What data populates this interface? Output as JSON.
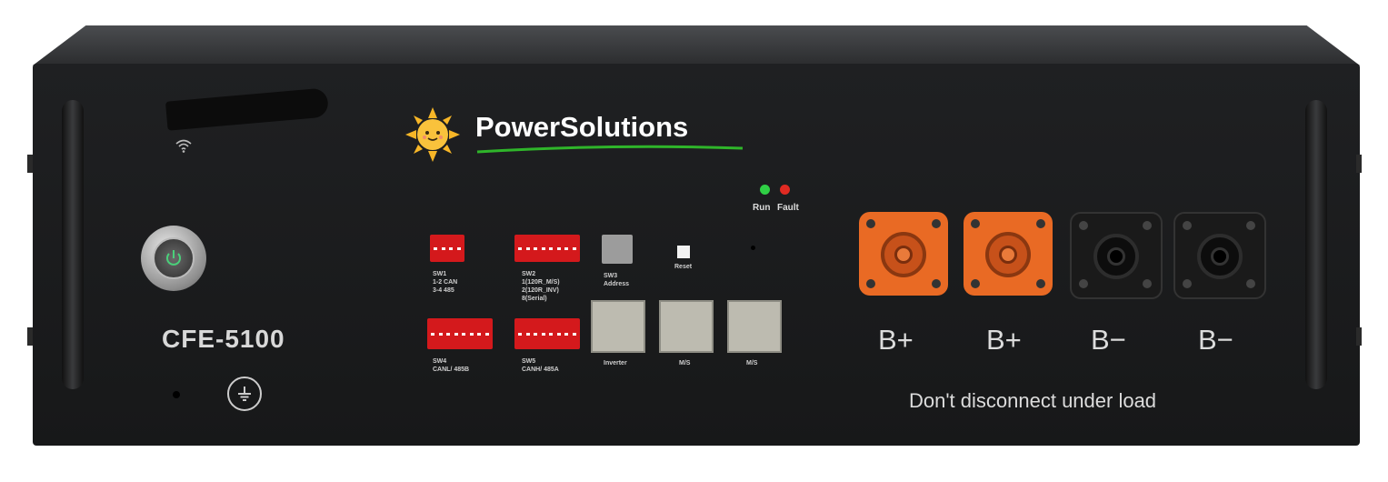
{
  "brand": {
    "name": "PowerSolutions",
    "colors": {
      "underline": "#2fb52a",
      "sun": "#f7b627"
    }
  },
  "model": "CFE-5100",
  "indicators": [
    {
      "label": "Run",
      "color": "#2fcf45"
    },
    {
      "label": "Fault",
      "color": "#e02a22"
    }
  ],
  "switches": {
    "sw1": "SW1\n1-2 CAN\n3-4 485",
    "sw2": "SW2\n1(120R_M/S)\n2(120R_INV)\n8(Serial)",
    "sw3": "SW3\nAddress",
    "sw4": "SW4\nCANL/ 485B",
    "sw5": "SW5\nCANH/ 485A"
  },
  "reset_label": "Reset",
  "ports": [
    "Inverter",
    "M/S",
    "M/S"
  ],
  "terminals": [
    "B+",
    "B+",
    "B−",
    "B−"
  ],
  "warning": "Don't disconnect under  load",
  "icons": [
    "wifi-icon",
    "power-icon",
    "ground-icon",
    "sun-logo-icon"
  ]
}
